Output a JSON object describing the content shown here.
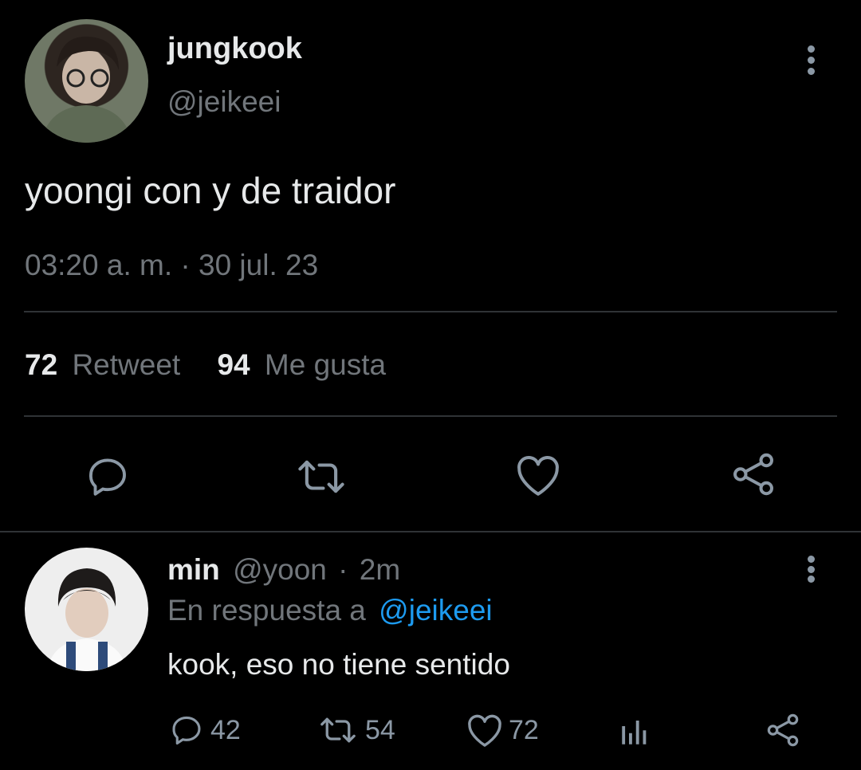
{
  "tweet": {
    "author_name": "jungkook",
    "handle": "@jeikeei",
    "text": "yoongi con y de traidor",
    "timestamp": "03:20 a. m. · 30 jul. 23",
    "retweets_count": "72",
    "retweets_label": "Retweet",
    "likes_count": "94",
    "likes_label": "Me gusta",
    "actions": [
      "reply-icon",
      "retweet-icon",
      "like-icon",
      "share-icon"
    ]
  },
  "reply": {
    "author_name": "min",
    "handle": "@yoon",
    "separator": "·",
    "time": "2m",
    "replying_prefix": "En respuesta a",
    "replying_to": "@jeikeei",
    "text": "kook, eso no tiene sentido",
    "reply_count": "42",
    "retweet_count": "54",
    "like_count": "72",
    "actions": [
      "reply-icon",
      "retweet-icon",
      "like-icon",
      "stats-icon",
      "share-icon"
    ]
  },
  "colors": {
    "background": "#000000",
    "text_primary": "#e7e9ea",
    "text_muted": "#71767b",
    "link": "#1d9bf0",
    "divider": "#2f3336"
  }
}
